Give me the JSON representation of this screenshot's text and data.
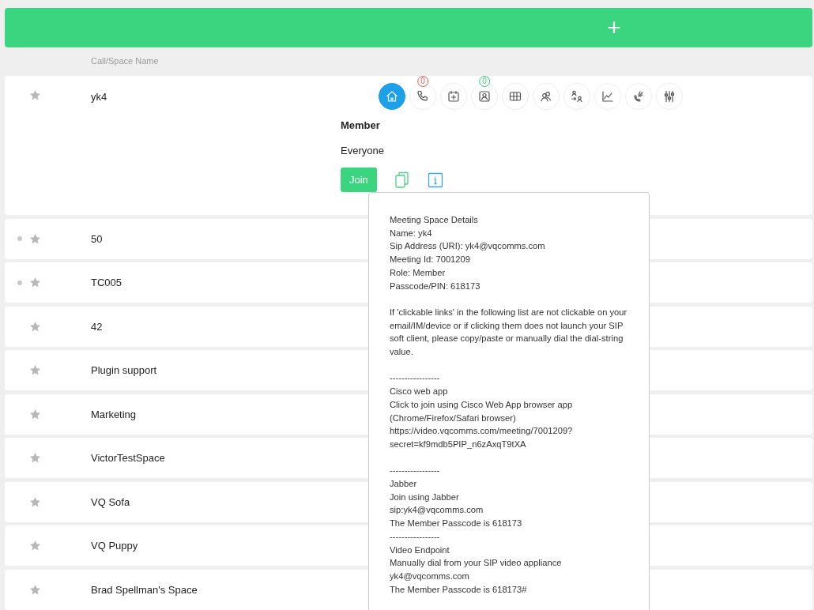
{
  "header": {
    "add_button": "+"
  },
  "list_header": "Call/Space Name",
  "expanded_space": {
    "name": "yk4",
    "starred": false,
    "dot": false,
    "tools": [
      {
        "kind": "home",
        "selected": true
      },
      {
        "kind": "phone",
        "selected": false,
        "badge": "0",
        "color": "#e05a5a"
      },
      {
        "kind": "calendar",
        "selected": false
      },
      {
        "kind": "presenter",
        "selected": false,
        "badge": "0",
        "color": "#3cc47c"
      },
      {
        "kind": "grid",
        "selected": false
      },
      {
        "kind": "people",
        "selected": false
      },
      {
        "kind": "transfer",
        "selected": false
      },
      {
        "kind": "chart",
        "selected": false
      },
      {
        "kind": "branch",
        "selected": false
      },
      {
        "kind": "sliders",
        "selected": false
      }
    ],
    "role_label": "Member",
    "role_value": "Everyone",
    "join_button": "Join"
  },
  "details_popover": {
    "blocks": [
      [
        "Meeting Space Details",
        "Name: yk4",
        "Sip Address (URI): yk4@vqcomms.com",
        "Meeting Id: 7001209",
        "Role: Member",
        "Passcode/PIN: 618173"
      ],
      [
        "If 'clickable links' in the following list are not clickable on your email/IM/device or if clicking them does not launch your SIP soft client, please copy/paste or manually dial the dial-string value."
      ],
      [
        "-----------------",
        "Cisco web app",
        "Click to join using Cisco Web App browser app",
        "(Chrome/Firefox/Safari browser)",
        "https://video.vqcomms.com/meeting/7001209?",
        "secret=kf9mdb5PIP_n6zAxqT9tXA"
      ],
      [
        "-----------------",
        "Jabber",
        "Join using Jabber",
        "sip:yk4@vqcomms.com",
        "The Member Passcode is 618173",
        "-----------------",
        "Video Endpoint",
        "Manually dial from your SIP video appliance",
        "yk4@vqcomms.com",
        "The Member Passcode is 618173#"
      ]
    ]
  },
  "spaces": [
    {
      "name": "50",
      "starred": false,
      "dot": true
    },
    {
      "name": "TC005",
      "starred": false,
      "dot": true
    },
    {
      "name": "42",
      "starred": false,
      "dot": false
    },
    {
      "name": "Plugin support",
      "starred": false,
      "dot": false
    },
    {
      "name": "Marketing",
      "starred": false,
      "dot": false
    },
    {
      "name": "VictorTestSpace",
      "starred": false,
      "dot": false
    },
    {
      "name": "VQ Sofa",
      "starred": false,
      "dot": false
    },
    {
      "name": "VQ Puppy",
      "starred": false,
      "dot": false
    },
    {
      "name": "Brad Spellman's Space",
      "starred": false,
      "dot": false
    }
  ]
}
